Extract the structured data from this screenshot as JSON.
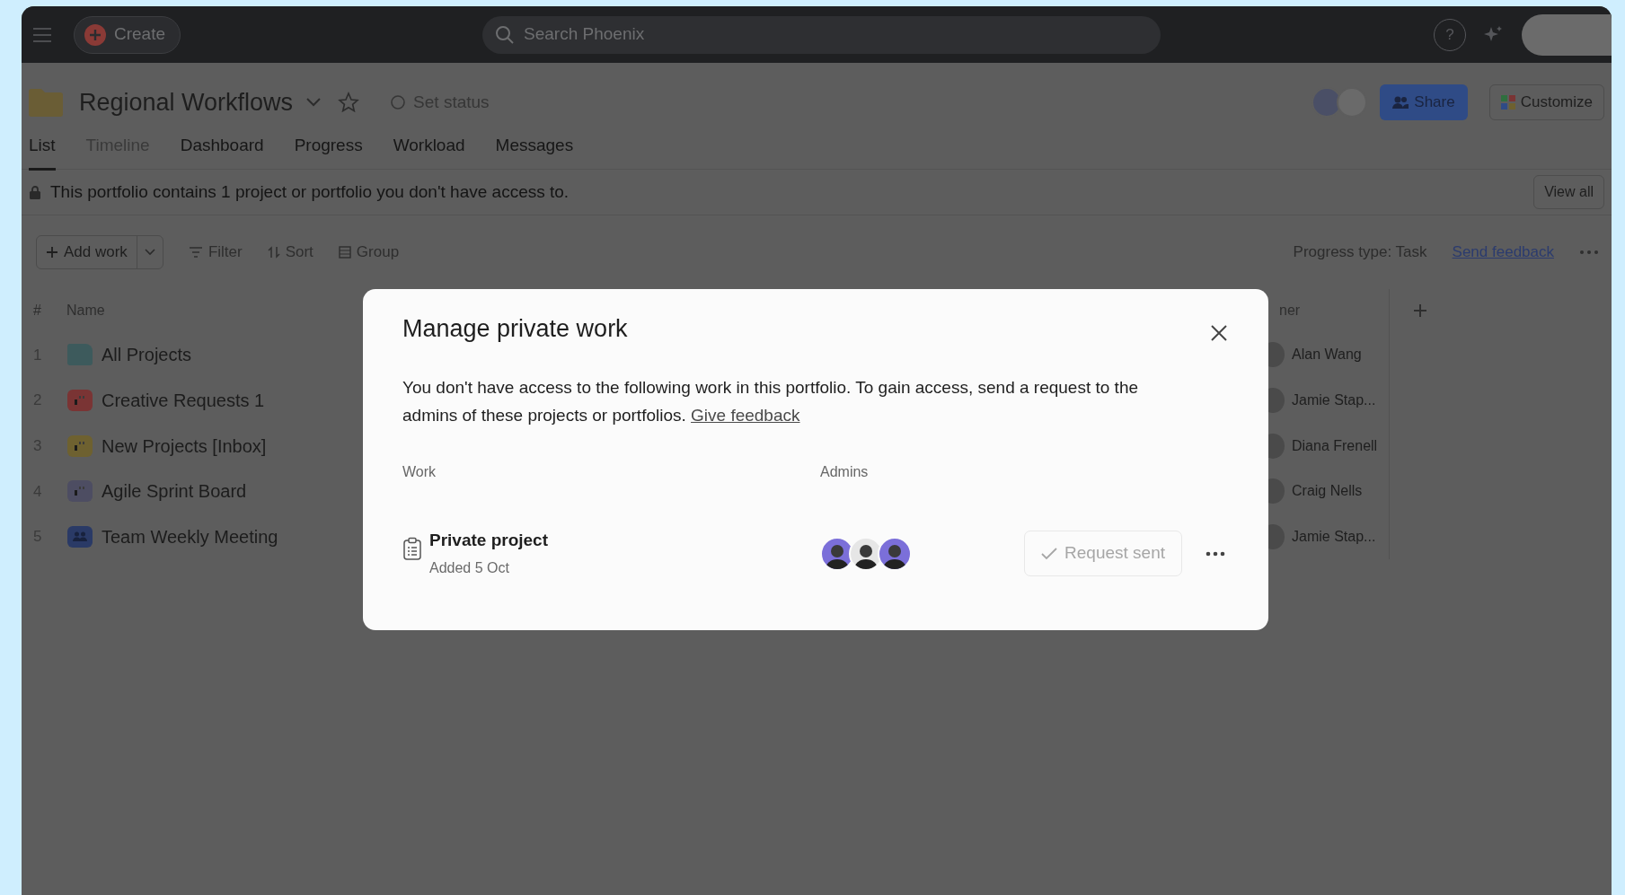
{
  "topbar": {
    "create": "Create",
    "search_placeholder": "Search Phoenix",
    "help": "?"
  },
  "header": {
    "title": "Regional Workflows",
    "set_status": "Set status",
    "share": "Share",
    "customize": "Customize"
  },
  "tabs": [
    {
      "label": "List",
      "selected": true,
      "disabled": false
    },
    {
      "label": "Timeline",
      "selected": false,
      "disabled": true
    },
    {
      "label": "Dashboard",
      "selected": false,
      "disabled": false
    },
    {
      "label": "Progress",
      "selected": false,
      "disabled": false
    },
    {
      "label": "Workload",
      "selected": false,
      "disabled": false
    },
    {
      "label": "Messages",
      "selected": false,
      "disabled": false
    }
  ],
  "banner": {
    "text": "This portfolio contains 1 project or portfolio you don't have access to.",
    "button": "View all"
  },
  "toolbar": {
    "add_work": "Add work",
    "filter": "Filter",
    "sort": "Sort",
    "group": "Group",
    "progress_type": "Progress type: Task",
    "send_feedback": "Send feedback"
  },
  "table": {
    "columns": [
      "#",
      "Name",
      "ner"
    ],
    "rows": [
      {
        "number": "1",
        "name": "All Projects",
        "kind": "folder",
        "color": "#3d5a5c",
        "owner": "Alan Wang"
      },
      {
        "number": "2",
        "name": "Creative Requests 1",
        "kind": "board",
        "color": "#7a3434",
        "owner": "Jamie Stap..."
      },
      {
        "number": "3",
        "name": "New Projects [Inbox]",
        "kind": "board",
        "color": "#6e6130",
        "owner": "Diana Frenell"
      },
      {
        "number": "4",
        "name": "Agile Sprint Board",
        "kind": "board",
        "color": "#4d4d62",
        "owner": "Craig Nells"
      },
      {
        "number": "5",
        "name": "Team Weekly Meeting",
        "kind": "meeting",
        "color": "#2a3a66",
        "owner": "Jamie Stap..."
      }
    ]
  },
  "modal": {
    "title": "Manage private work",
    "body": "You don't have access to the following work in this portfolio. To gain access, send a request to the admins of these projects or portfolios.",
    "link": "Give feedback",
    "columns": [
      "Work",
      "Admins"
    ],
    "items": [
      {
        "name": "Private project",
        "added": "Added 5 Oct",
        "admins": [
          {
            "color": "#7b6fd9"
          },
          {
            "color": "#e6e6e6"
          },
          {
            "color": "#7b6fd9"
          }
        ],
        "button": "Request sent",
        "disabled": true
      }
    ]
  }
}
